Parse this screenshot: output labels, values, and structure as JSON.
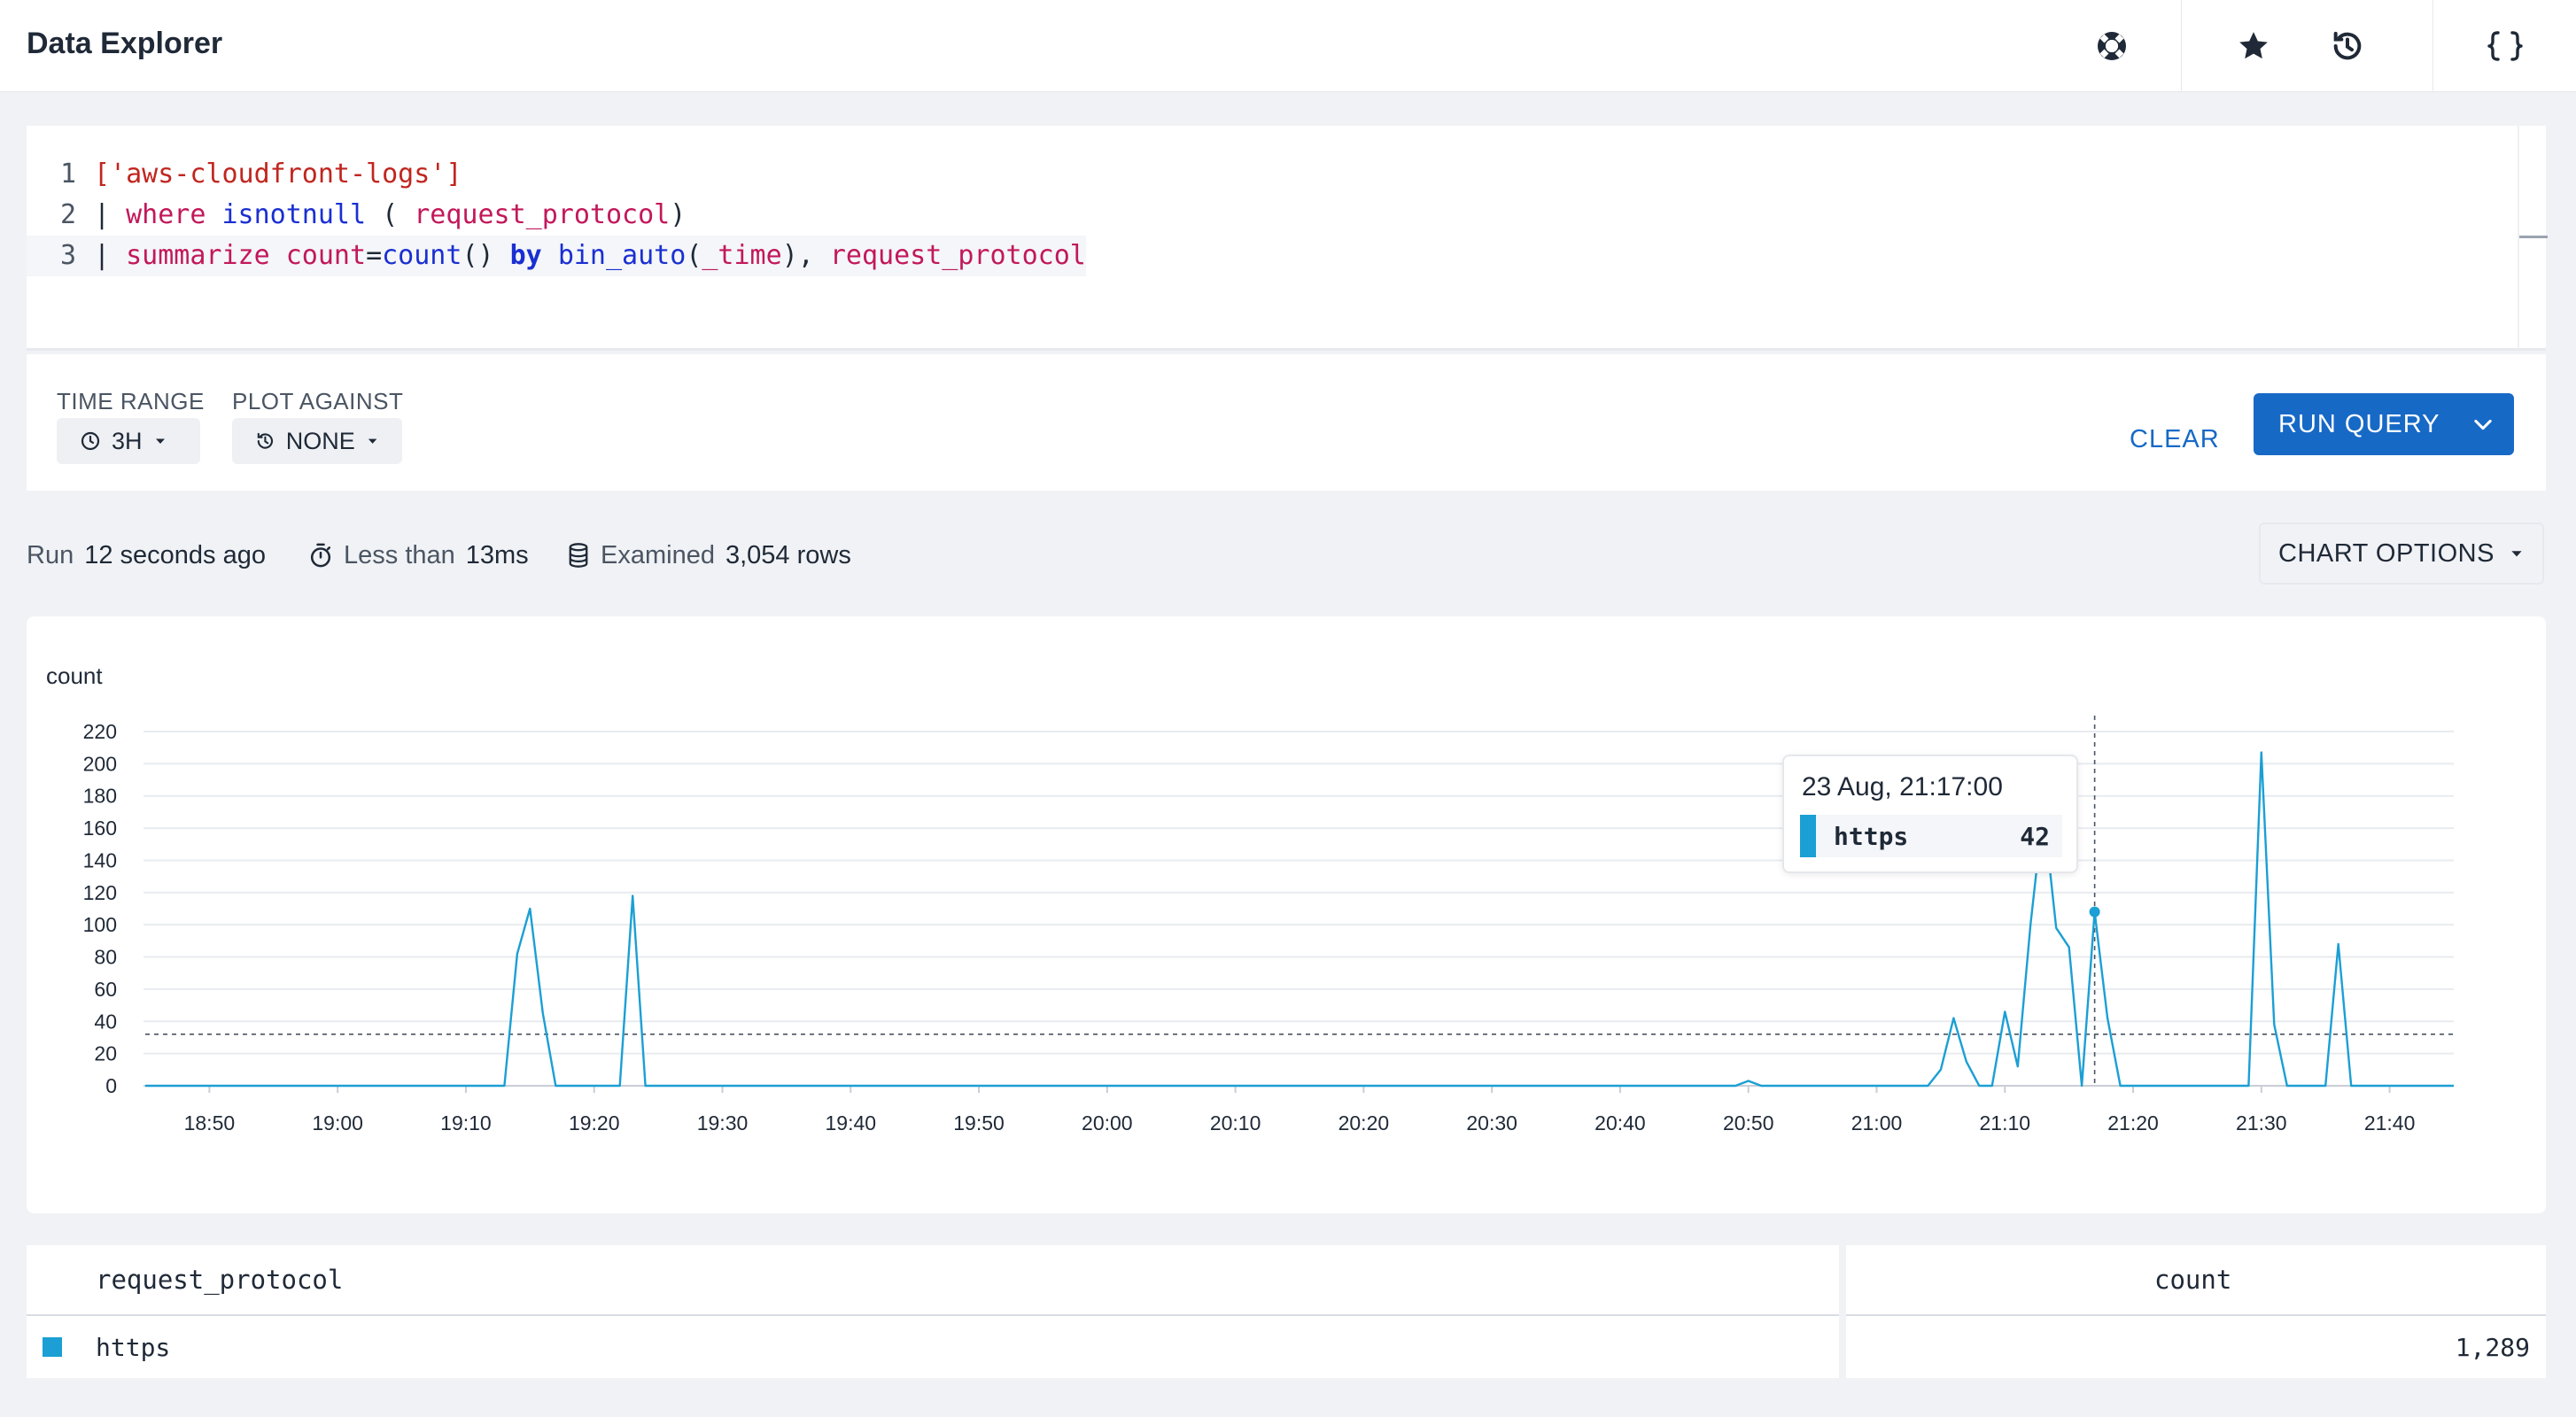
{
  "header": {
    "title": "Data Explorer",
    "icons": [
      "help-lifebuoy-icon",
      "star-icon",
      "history-icon",
      "json-braces-icon"
    ]
  },
  "editor": {
    "lines": [
      {
        "num": "1",
        "tokens": [
          {
            "t": "str",
            "v": "['aws-cloudfront-logs']"
          }
        ]
      },
      {
        "num": "2",
        "tokens": [
          {
            "t": "op",
            "v": "| "
          },
          {
            "t": "kw",
            "v": "where"
          },
          {
            "t": "op",
            "v": " "
          },
          {
            "t": "fn",
            "v": "isnotnull"
          },
          {
            "t": "op",
            "v": " ( "
          },
          {
            "t": "id",
            "v": "request_protocol"
          },
          {
            "t": "op",
            "v": ")"
          }
        ]
      },
      {
        "num": "3",
        "tokens": [
          {
            "t": "op",
            "v": "| "
          },
          {
            "t": "kw",
            "v": "summarize"
          },
          {
            "t": "op",
            "v": " "
          },
          {
            "t": "id",
            "v": "count"
          },
          {
            "t": "op",
            "v": "="
          },
          {
            "t": "fn",
            "v": "count"
          },
          {
            "t": "op",
            "v": "() "
          },
          {
            "t": "by",
            "v": "by"
          },
          {
            "t": "op",
            "v": " "
          },
          {
            "t": "fn",
            "v": "bin_auto"
          },
          {
            "t": "op",
            "v": "("
          },
          {
            "t": "id",
            "v": "_time"
          },
          {
            "t": "op",
            "v": "), "
          },
          {
            "t": "id",
            "v": "request_protocol"
          }
        ]
      }
    ]
  },
  "query": {
    "time_range_label": "TIME RANGE",
    "time_range_value": "3H",
    "plot_against_label": "PLOT AGAINST",
    "plot_against_value": "NONE",
    "clear_label": "CLEAR",
    "run_label": "RUN QUERY"
  },
  "stats": {
    "run_prefix": "Run",
    "run_value": "12 seconds ago",
    "duration_prefix": "Less than",
    "duration_value": "13ms",
    "examined_prefix": "Examined",
    "examined_value": "3,054 rows",
    "chart_options_label": "CHART OPTIONS"
  },
  "chart_data": {
    "type": "line",
    "title": "count",
    "ylabel": "count",
    "xlabel": "",
    "ylim": [
      0,
      220
    ],
    "yticks": [
      0,
      20,
      40,
      60,
      80,
      100,
      120,
      140,
      160,
      180,
      200,
      220
    ],
    "xticks": [
      "18:50",
      "19:00",
      "19:10",
      "19:20",
      "19:30",
      "19:40",
      "19:50",
      "20:00",
      "20:10",
      "20:20",
      "20:30",
      "20:40",
      "20:50",
      "21:00",
      "21:10",
      "21:20",
      "21:30",
      "21:40"
    ],
    "x_start_minutes": 1125,
    "x_end_minutes": 1305,
    "grid": true,
    "series": [
      {
        "name": "https",
        "color": "#1b9fd4",
        "points": [
          [
            "18:45",
            0
          ],
          [
            "19:13",
            0
          ],
          [
            "19:14",
            82
          ],
          [
            "19:15",
            110
          ],
          [
            "19:16",
            45
          ],
          [
            "19:17",
            0
          ],
          [
            "19:22",
            0
          ],
          [
            "19:23",
            118
          ],
          [
            "19:24",
            0
          ],
          [
            "20:49",
            0
          ],
          [
            "20:50",
            3
          ],
          [
            "20:51",
            0
          ],
          [
            "21:04",
            0
          ],
          [
            "21:05",
            10
          ],
          [
            "21:06",
            42
          ],
          [
            "21:07",
            15
          ],
          [
            "21:08",
            0
          ],
          [
            "21:09",
            0
          ],
          [
            "21:10",
            46
          ],
          [
            "21:11",
            12
          ],
          [
            "21:12",
            100
          ],
          [
            "21:13",
            172
          ],
          [
            "21:14",
            98
          ],
          [
            "21:15",
            86
          ],
          [
            "21:16",
            0
          ],
          [
            "21:17",
            108
          ],
          [
            "21:18",
            42
          ],
          [
            "21:19",
            0
          ],
          [
            "21:29",
            0
          ],
          [
            "21:30",
            207
          ],
          [
            "21:31",
            38
          ],
          [
            "21:32",
            0
          ],
          [
            "21:35",
            0
          ],
          [
            "21:36",
            88
          ],
          [
            "21:37",
            0
          ],
          [
            "21:45",
            0
          ]
        ]
      }
    ],
    "reference_line": 32,
    "crosshair_time": "21:17",
    "tooltip": {
      "time": "23 Aug, 21:17:00",
      "series": "https",
      "value": "42"
    }
  },
  "table": {
    "columns": [
      "request_protocol",
      "count"
    ],
    "rows": [
      {
        "request_protocol": "https",
        "count": "1,289"
      }
    ]
  }
}
